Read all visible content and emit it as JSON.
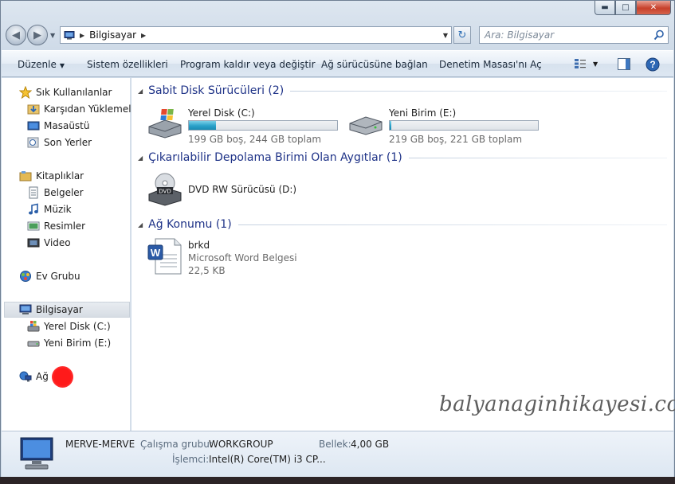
{
  "window": {
    "controls": {
      "minimize": "▬",
      "maximize": "□",
      "close": "✕"
    }
  },
  "address": {
    "crumb": "Bilgisayar",
    "search_placeholder": "Ara: Bilgisayar"
  },
  "toolbar": {
    "organize": "Düzenle",
    "system_properties": "Sistem özellikleri",
    "uninstall": "Program kaldır veya değiştir",
    "map_drive": "Ağ sürücüsüne bağlan",
    "control_panel": "Denetim Masası'nı Aç"
  },
  "sidebar": {
    "favorites": "Sık Kullanılanlar",
    "downloads": "Karşıdan Yüklemeler",
    "desktop": "Masaüstü",
    "recent": "Son Yerler",
    "libraries": "Kitaplıklar",
    "documents": "Belgeler",
    "music": "Müzik",
    "pictures": "Resimler",
    "videos": "Video",
    "homegroup": "Ev Grubu",
    "computer": "Bilgisayar",
    "drive_c": "Yerel Disk (C:)",
    "drive_e": "Yeni Birim (E:)",
    "network": "Ağ"
  },
  "groups": {
    "hdd": "Sabit Disk Sürücüleri (2)",
    "removable": "Çıkarılabilir Depolama Birimi Olan Aygıtlar (1)",
    "network": "Ağ Konumu (1)"
  },
  "drives": [
    {
      "name": "Yerel Disk (C:)",
      "free": "199 GB boş, 244 GB toplam",
      "used_fraction": 0.184
    },
    {
      "name": "Yeni Birim (E:)",
      "free": "219 GB boş, 221 GB toplam",
      "used_fraction": 0.009
    }
  ],
  "dvd": {
    "name": "DVD RW Sürücüsü (D:)",
    "badge": "DVD"
  },
  "network_item": {
    "name": "brkd",
    "type": "Microsoft Word Belgesi",
    "size": "22,5 KB"
  },
  "watermark": "balyanaginhikayesi.com",
  "details": {
    "computer_name": "MERVE-MERVE",
    "workgroup_label": "Çalışma grubu:",
    "workgroup_value": "WORKGROUP",
    "memory_label": "Bellek:",
    "memory_value": "4,00 GB",
    "processor_label": "İşlemci:",
    "processor_value": "Intel(R) Core(TM) i3 CP..."
  },
  "colors": {
    "group_header": "#1e3287",
    "accent_fill": "#2aa1c9",
    "annotation_dot": "#ff1a1a"
  }
}
